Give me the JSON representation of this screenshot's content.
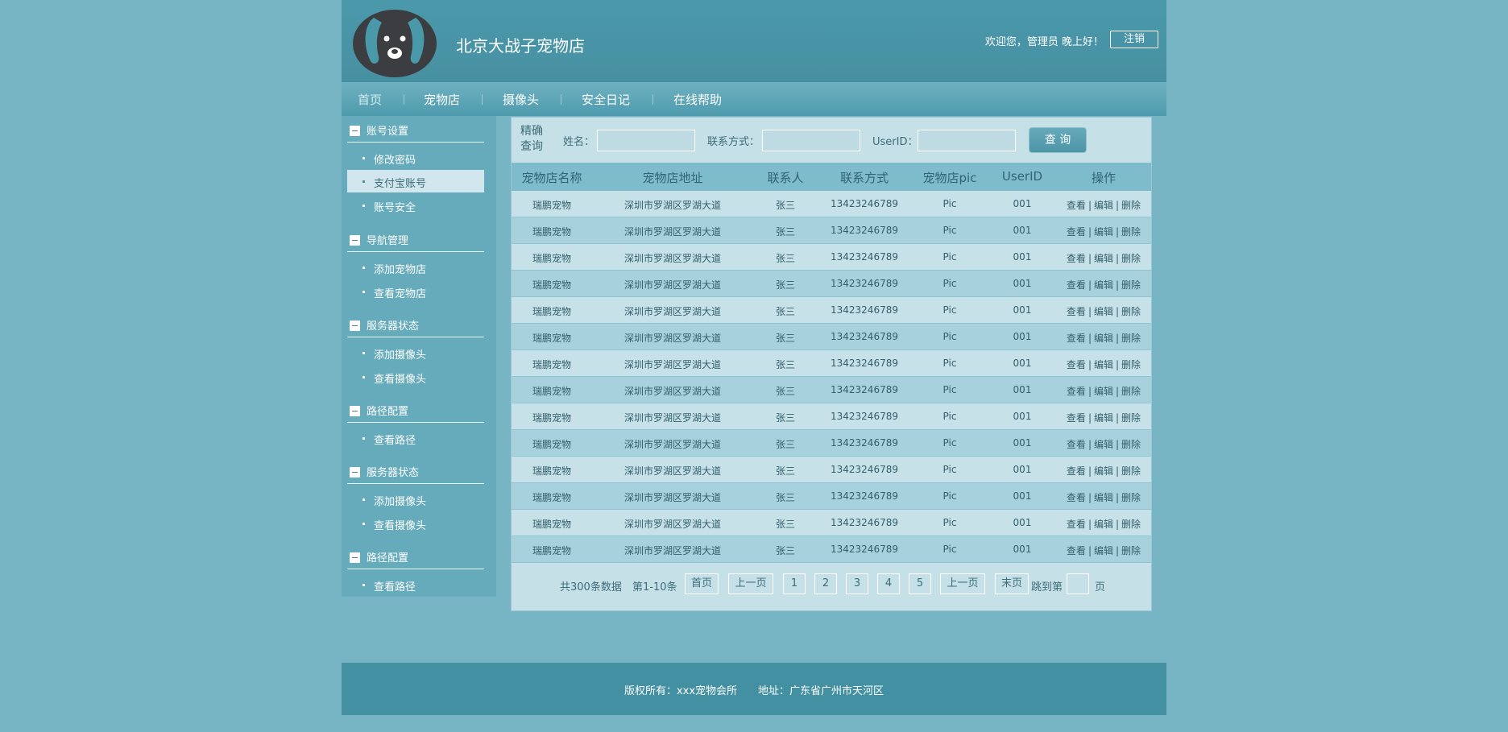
{
  "header": {
    "site_title": "北京大战子宠物店",
    "welcome": "欢迎您，管理员 晚上好！",
    "logout_label": "注销"
  },
  "nav": {
    "items": [
      "首页",
      "宠物店",
      "摄像头",
      "安全日记",
      "在线帮助"
    ]
  },
  "sidebar": {
    "groups": [
      {
        "title": "账号设置",
        "items": [
          "修改密码",
          "支付宝账号",
          "账号安全"
        ]
      },
      {
        "title": "导航管理",
        "items": [
          "添加宠物店",
          "查看宠物店"
        ]
      },
      {
        "title": "服务器状态",
        "items": [
          "添加摄像头",
          "查看摄像头"
        ]
      },
      {
        "title": "路径配置",
        "items": [
          "查看路径"
        ]
      },
      {
        "title": "服务器状态",
        "items": [
          "添加摄像头",
          "查看摄像头"
        ]
      },
      {
        "title": "路径配置",
        "items": [
          "查看路径"
        ]
      }
    ],
    "active_item": "支付宝账号"
  },
  "search": {
    "title": "精确查询",
    "name_label": "姓名：",
    "contact_label": "联系方式：",
    "userid_label": "UserID：",
    "query_label": "查 询"
  },
  "table": {
    "headers": [
      "宠物店名称",
      "宠物店地址",
      "联系人",
      "联系方式",
      "宠物店pic",
      "UserID",
      "操作"
    ],
    "rows": [
      [
        "瑞鹏宠物",
        "深圳市罗湖区罗湖大道",
        "张三",
        "13423246789",
        "Pic",
        "001"
      ],
      [
        "瑞鹏宠物",
        "深圳市罗湖区罗湖大道",
        "张三",
        "13423246789",
        "Pic",
        "001"
      ],
      [
        "瑞鹏宠物",
        "深圳市罗湖区罗湖大道",
        "张三",
        "13423246789",
        "Pic",
        "001"
      ],
      [
        "瑞鹏宠物",
        "深圳市罗湖区罗湖大道",
        "张三",
        "13423246789",
        "Pic",
        "001"
      ],
      [
        "瑞鹏宠物",
        "深圳市罗湖区罗湖大道",
        "张三",
        "13423246789",
        "Pic",
        "001"
      ],
      [
        "瑞鹏宠物",
        "深圳市罗湖区罗湖大道",
        "张三",
        "13423246789",
        "Pic",
        "001"
      ],
      [
        "瑞鹏宠物",
        "深圳市罗湖区罗湖大道",
        "张三",
        "13423246789",
        "Pic",
        "001"
      ],
      [
        "瑞鹏宠物",
        "深圳市罗湖区罗湖大道",
        "张三",
        "13423246789",
        "Pic",
        "001"
      ],
      [
        "瑞鹏宠物",
        "深圳市罗湖区罗湖大道",
        "张三",
        "13423246789",
        "Pic",
        "001"
      ],
      [
        "瑞鹏宠物",
        "深圳市罗湖区罗湖大道",
        "张三",
        "13423246789",
        "Pic",
        "001"
      ],
      [
        "瑞鹏宠物",
        "深圳市罗湖区罗湖大道",
        "张三",
        "13423246789",
        "Pic",
        "001"
      ],
      [
        "瑞鹏宠物",
        "深圳市罗湖区罗湖大道",
        "张三",
        "13423246789",
        "Pic",
        "001"
      ],
      [
        "瑞鹏宠物",
        "深圳市罗湖区罗湖大道",
        "张三",
        "13423246789",
        "Pic",
        "001"
      ],
      [
        "瑞鹏宠物",
        "深圳市罗湖区罗湖大道",
        "张三",
        "13423246789",
        "Pic",
        "001"
      ]
    ],
    "ops": [
      "查看",
      "编辑",
      "删除"
    ],
    "ops_sep": "|"
  },
  "pager": {
    "total": "共300条数据",
    "range": "第1-10条",
    "first": "首页",
    "prev": "上一页",
    "pages": [
      "1",
      "2",
      "3",
      "4",
      "5"
    ],
    "next": "上一页",
    "last": "末页",
    "jump_prefix": "跳到第",
    "jump_suffix": "页"
  },
  "footer": {
    "text": "版权所有：xxx宠物会所　　地址：广东省广州市天河区"
  },
  "colors": {
    "page_bg": "#78b5c4",
    "header_bg": "#4a99ab",
    "content_bg": "#c5e0e7",
    "footer_bg": "#4290a2"
  },
  "icons": {
    "logo": "dog-face-logo-icon",
    "group": "minus-box-icon"
  }
}
